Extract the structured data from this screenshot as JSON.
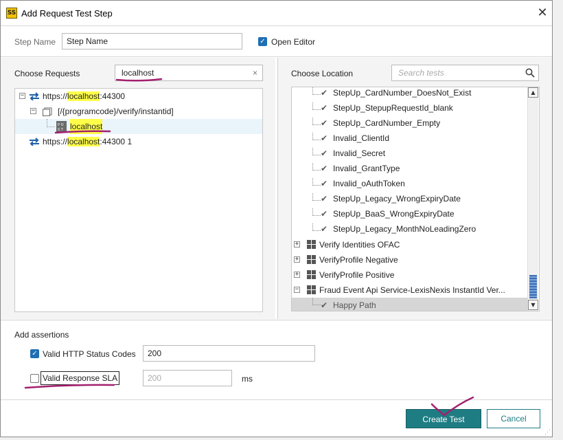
{
  "window": {
    "title": "Add Request Test Step",
    "icon_text": "SS"
  },
  "step": {
    "name_label": "Step Name",
    "name_value": "Step Name",
    "open_editor_label": "Open Editor",
    "open_editor_checked": true
  },
  "requests": {
    "label": "Choose Requests",
    "search_value": "localhost",
    "clear_glyph": "×",
    "tree": {
      "endpoint1_prefix": "https://",
      "endpoint1_host": "localhost",
      "endpoint1_suffix": ":44300",
      "resource": "[/{programcode}/verify/instantid]",
      "method_badge": "POST",
      "request_name": "localhost",
      "endpoint2_prefix": "https://",
      "endpoint2_host": "localhost",
      "endpoint2_suffix": ":44300 1"
    }
  },
  "location": {
    "label": "Choose Location",
    "search_placeholder": "Search tests",
    "items": [
      {
        "text": "StepUp_CardNumber_DoesNot_Exist"
      },
      {
        "text": "StepUp_StepupRequestId_blank"
      },
      {
        "text": "StepUp_CardNumber_Empty"
      },
      {
        "text": "Invalid_ClientId"
      },
      {
        "text": "Invalid_Secret"
      },
      {
        "text": "Invalid_GrantType"
      },
      {
        "text": "Invalid_oAuthToken"
      },
      {
        "text": "StepUp_Legacy_WrongExpiryDate"
      },
      {
        "text": "StepUp_BaaS_WrongExpiryDate"
      },
      {
        "text": "StepUp_Legacy_MonthNoLeadingZero"
      }
    ],
    "suites": [
      {
        "text": "Verify Identities OFAC",
        "expanded": false
      },
      {
        "text": "VerifyProfile Negative",
        "expanded": false
      },
      {
        "text": "VerifyProfile Positive",
        "expanded": false
      },
      {
        "text": "Fraud Event Api Service-LexisNexis InstantId Ver...",
        "expanded": true
      }
    ],
    "selected_case": "Happy Path",
    "scroll_up_glyph": "▲",
    "scroll_down_glyph": "▼"
  },
  "assertions": {
    "heading": "Add assertions",
    "status_codes_label": "Valid HTTP Status Codes",
    "status_codes_checked": true,
    "status_codes_value": "200",
    "sla_label": "Valid Response SLA",
    "sla_checked": false,
    "sla_placeholder": "200",
    "sla_unit": "ms"
  },
  "buttons": {
    "create": "Create Test",
    "cancel": "Cancel"
  },
  "colors": {
    "accent": "#1e7d83",
    "highlight": "#ffff4a",
    "annotation": "#a3206f",
    "link_blue": "#1e6fb4"
  }
}
